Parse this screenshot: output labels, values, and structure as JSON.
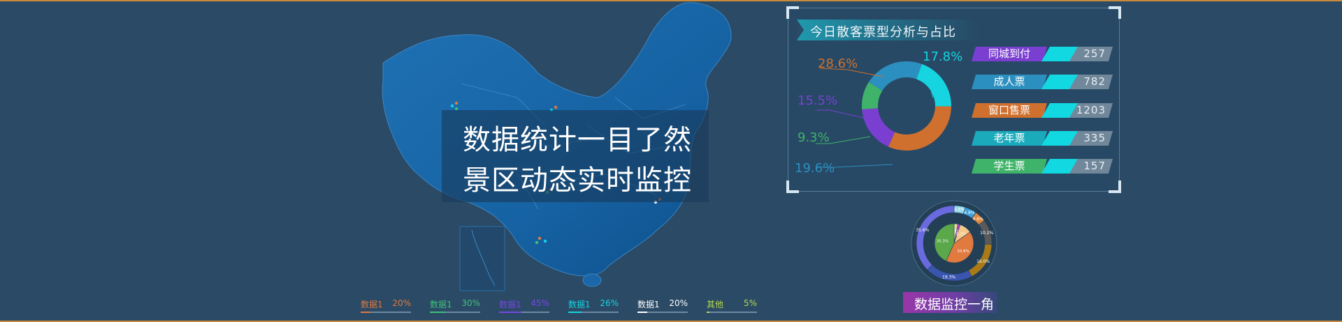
{
  "headline": {
    "line1": "数据统计一目了然",
    "line2": "景区动态实时监控"
  },
  "legend": [
    {
      "name": "数据1",
      "pct": "20%",
      "color": "#e07a3f",
      "ratio": 0.2
    },
    {
      "name": "数据1",
      "pct": "30%",
      "color": "#3fc07a",
      "ratio": 0.3
    },
    {
      "name": "数据1",
      "pct": "45%",
      "color": "#7b46e0",
      "ratio": 0.45
    },
    {
      "name": "数据1",
      "pct": "26%",
      "color": "#16d4e0",
      "ratio": 0.26
    },
    {
      "name": "数据1",
      "pct": "20%",
      "color": "#ffffff",
      "ratio": 0.2
    },
    {
      "name": "其他",
      "pct": "5%",
      "color": "#b6d94a",
      "ratio": 0.05
    }
  ],
  "ticket_panel": {
    "title": "今日散客票型分析与占比",
    "donut": [
      {
        "label": "17.8%",
        "value": 17.8,
        "color": "#16d4e0"
      },
      {
        "label": "28.6%",
        "value": 28.6,
        "color": "#d0702e"
      },
      {
        "label": "15.5%",
        "value": 15.5,
        "color": "#7a3fd1"
      },
      {
        "label": "9.3%",
        "value": 9.3,
        "color": "#3fb36a"
      },
      {
        "label": "19.6%",
        "value": 19.6,
        "color": "#2b8fbf"
      }
    ],
    "rows": [
      {
        "label": "同城到付",
        "value": "257",
        "color": "#7a3fd1"
      },
      {
        "label": "成人票",
        "value": "782",
        "color": "#2b8fbf"
      },
      {
        "label": "窗口售票",
        "value": "1203",
        "color": "#d0702e"
      },
      {
        "label": "老年票",
        "value": "335",
        "color": "#1aaabb"
      },
      {
        "label": "学生票",
        "value": "157",
        "color": "#3fb36a"
      }
    ]
  },
  "monitor": {
    "caption": "数据监控一角",
    "outer_ring": [
      {
        "label": "4.6%",
        "value": 4.6,
        "color": "#8fd6ea"
      },
      {
        "label": "4.8%",
        "value": 4.8,
        "color": "#3fa0d8"
      },
      {
        "label": "4.6%",
        "value": 4.6,
        "color": "#e0883f"
      },
      {
        "label": "10.2%",
        "value": 10.2,
        "color": "#5a5a5a"
      },
      {
        "label": "16.0%",
        "value": 16.0,
        "color": "#a97b18"
      },
      {
        "label": "19.3%",
        "value": 19.3,
        "color": "#3a55b0"
      },
      {
        "label": "35.6%",
        "value": 35.6,
        "color": "#6a6adf"
      }
    ],
    "inner_pie": [
      {
        "label": "2.5%",
        "value": 2.5,
        "color": "#e8e0a0"
      },
      {
        "label": "1.7%",
        "value": 1.7,
        "color": "#c04ad0"
      },
      {
        "label": "8.2%",
        "value": 8.2,
        "color": "#f3c98a"
      },
      {
        "label": "33.8%",
        "value": 33.8,
        "color": "#e07a3f"
      },
      {
        "label": "35.3%",
        "value": 35.3,
        "color": "#5aa84a"
      }
    ]
  }
}
